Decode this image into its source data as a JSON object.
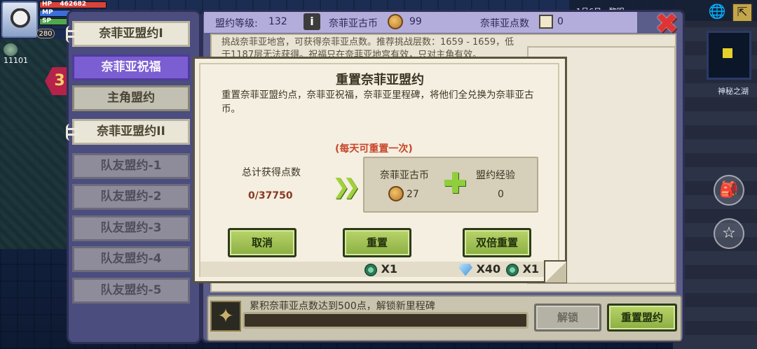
{
  "hud": {
    "hp_label": "HP",
    "hp_value": "462682",
    "mp_label": "MP",
    "sp_label": "SP",
    "level": "280",
    "currency": "11101",
    "badge_number": "3"
  },
  "right_hud": {
    "top_text": "1月6日 · 黎明",
    "map_label": "神秘之湖"
  },
  "sidebar": {
    "tabs": [
      {
        "label": "奈菲亚盟约I"
      },
      {
        "label": "奈菲亚祝福"
      },
      {
        "label": "主角盟约"
      },
      {
        "label": "奈菲亚盟约II"
      },
      {
        "label": "队友盟约-1"
      },
      {
        "label": "队友盟约-2"
      },
      {
        "label": "队友盟约-3"
      },
      {
        "label": "队友盟约-4"
      },
      {
        "label": "队友盟约-5"
      }
    ]
  },
  "header": {
    "level_label": "盟约等级:",
    "level_value": "132",
    "coin_label": "奈菲亚古币",
    "coin_value": "99",
    "points_label": "奈菲亚点数",
    "points_value": "0"
  },
  "panel": {
    "description": "挑战奈菲亚地宫，可获得奈菲亚点数。推荐挑战层数：1659 - 1659，低于1187层无法获得。祝福只在奈菲亚地宫有效，只对主角有效。",
    "milestone_text": "累积奈菲亚点数达到500点，解锁新里程碑",
    "unlock_label": "解锁",
    "reset_pact_label": "重置盟约"
  },
  "modal": {
    "title": "重置奈菲亚盟约",
    "description": "重置奈菲亚盟约点，奈菲亚祝福，奈菲亚里程碑，将他们全兑换为奈菲亚古币。",
    "note": "(每天可重置一次)",
    "total_label": "总计获得点数",
    "total_value": "0/37750",
    "reward_coin_label": "奈菲亚古币",
    "reward_coin_value": "27",
    "reward_exp_label": "盟约经验",
    "reward_exp_value": "0",
    "cancel_label": "取消",
    "reset_label": "重置",
    "double_reset_label": "双倍重置",
    "reset_cost": "X1",
    "double_cost_diamond": "X40",
    "double_cost_gem": "X1"
  },
  "colors": {
    "accent_purple": "#7b5ed1",
    "button_green": "#9fc253",
    "note_red": "#c8462a",
    "close_red": "#e03434"
  },
  "icons": [
    "info-icon",
    "coin-icon",
    "card-icon",
    "close-icon",
    "arrow-right-icon",
    "plus-icon",
    "gem-icon",
    "diamond-icon",
    "sigil-icon",
    "globe-icon",
    "exit-icon",
    "star-icon",
    "bag-icon"
  ]
}
